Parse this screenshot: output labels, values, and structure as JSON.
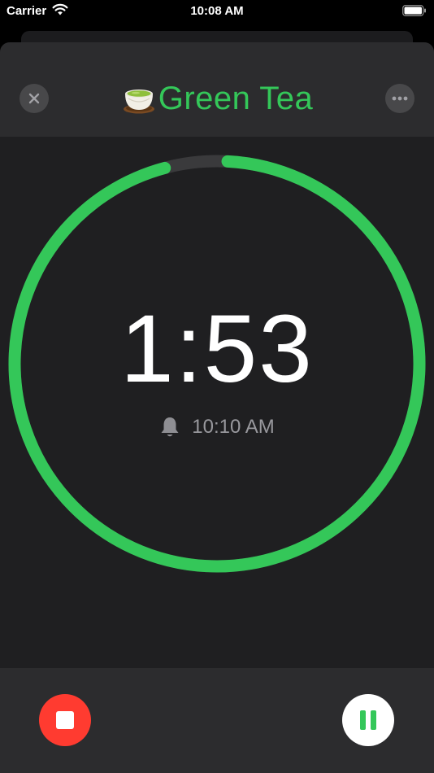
{
  "status_bar": {
    "carrier": "Carrier",
    "time": "10:08 AM"
  },
  "timer": {
    "title": "Green Tea",
    "time_remaining": "1:53",
    "alarm_time": "10:10 AM",
    "progress_remaining_fraction": 0.95
  },
  "icons": {
    "close": "close-icon",
    "more": "more-icon",
    "title_icon": "tea-cup-icon",
    "alarm": "bell-icon",
    "stop": "stop-icon",
    "pause": "pause-icon"
  },
  "colors": {
    "accent_green": "#34c759",
    "stop_red": "#ff3b30",
    "track": "#3a3a3c"
  }
}
